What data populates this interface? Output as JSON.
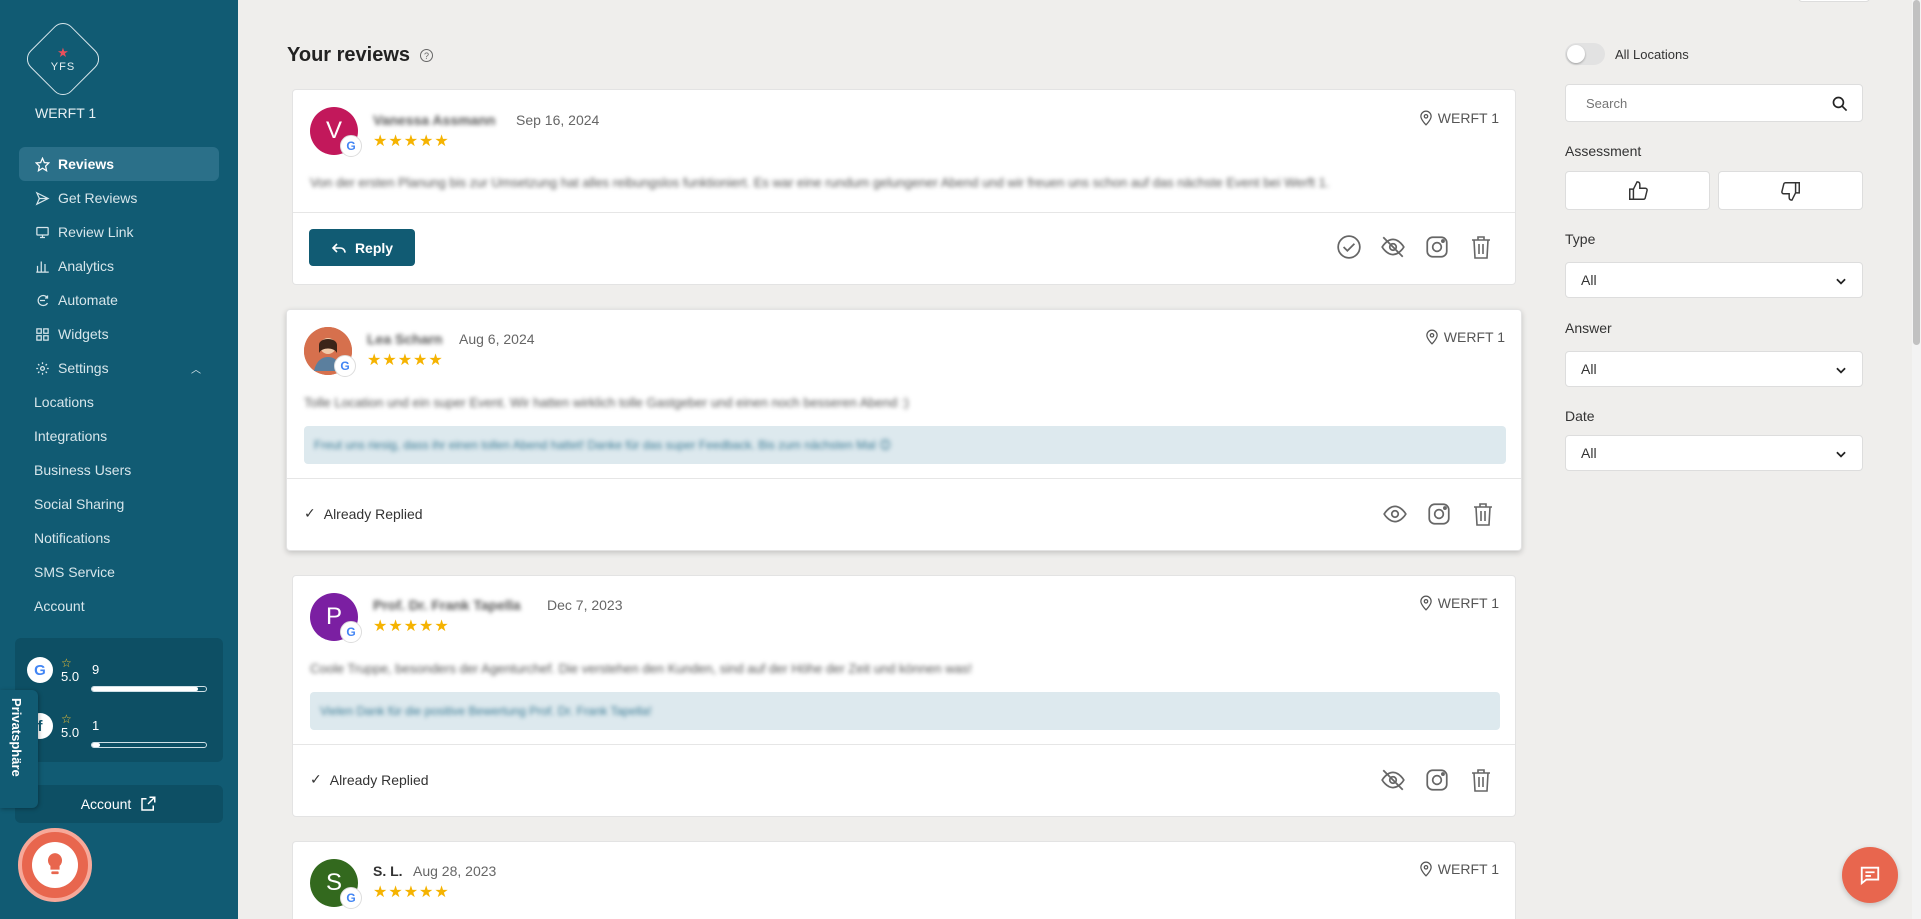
{
  "app": {
    "logo_text": "YFS",
    "company": "WERFT 1"
  },
  "sidebar": {
    "items": [
      {
        "label": "Reviews",
        "icon": "star-icon"
      },
      {
        "label": "Get Reviews",
        "icon": "send-icon"
      },
      {
        "label": "Review Link",
        "icon": "monitor-icon"
      },
      {
        "label": "Analytics",
        "icon": "bar-chart-icon"
      },
      {
        "label": "Automate",
        "icon": "automate-icon"
      },
      {
        "label": "Widgets",
        "icon": "widgets-icon"
      },
      {
        "label": "Settings",
        "icon": "gear-icon"
      }
    ],
    "settings_sub": [
      "Locations",
      "Integrations",
      "Business Users",
      "Social Sharing",
      "Notifications",
      "SMS Service",
      "Account"
    ],
    "stats": [
      {
        "platform": "Google",
        "score": "5.0",
        "count": "9",
        "fill": 0.93
      },
      {
        "platform": "Other",
        "score": "5.0",
        "count": "1",
        "fill": 0.07
      }
    ],
    "account_button": "Account",
    "privacy_tab": "Privatsphäre"
  },
  "main": {
    "title": "Your reviews",
    "help": "?",
    "reviews": [
      {
        "initial": "V",
        "name": "Vanessa Assmann",
        "date": "Sep 16, 2024",
        "location": "WERFT 1",
        "stars": "★★★★★",
        "text": "Von der ersten Planung bis zur Umsetzung hat alles reibungslos funktioniert. Es war eine rundum gelungener Abend und wir freuen uns schon auf das nächste Event bei Werft 1.",
        "reply": "",
        "action_label": "Reply",
        "avatar_color": "#c2185b"
      },
      {
        "initial": "",
        "name": "Lea Scharn",
        "date": "Aug 6, 2024",
        "location": "WERFT 1",
        "stars": "★★★★★",
        "text": "Tolle Location und ein super Event. Wir hatten wirklich tolle Gastgeber und einen noch besseren Abend :)",
        "reply": "Freut uns riesig, dass ihr einen tollen Abend hattet! Danke für das super Feedback. Bis zum nächsten Mal 😊",
        "action_label": "Already Replied",
        "avatar_color": "#c8694a"
      },
      {
        "initial": "P",
        "name": "Prof. Dr. Frank Tapella",
        "date": "Dec 7, 2023",
        "location": "WERFT 1",
        "stars": "★★★★★",
        "text": "Coole Truppe, besonders der Agenturchef. Die verstehen den Kunden, sind auf der Höhe der Zeit und können was!",
        "reply": "Vielen Dank für die positive Bewertung Prof. Dr. Frank Tapella!",
        "action_label": "Already Replied",
        "avatar_color": "#7b1fa2"
      },
      {
        "initial": "S",
        "name": "S. L.",
        "date": "Aug 28, 2023",
        "location": "WERFT 1",
        "stars": "★★★★★",
        "text": "",
        "reply": "",
        "action_label": "",
        "avatar_color": "#33691e"
      }
    ]
  },
  "filters": {
    "all_locations": "All Locations",
    "search_placeholder": "Search",
    "assessment_label": "Assessment",
    "type_label": "Type",
    "type_value": "All",
    "answer_label": "Answer",
    "answer_value": "All",
    "date_label": "Date",
    "date_value": "All"
  },
  "colors": {
    "sidebar": "#115b73",
    "accent": "#e8664e",
    "star": "#f5b301"
  }
}
